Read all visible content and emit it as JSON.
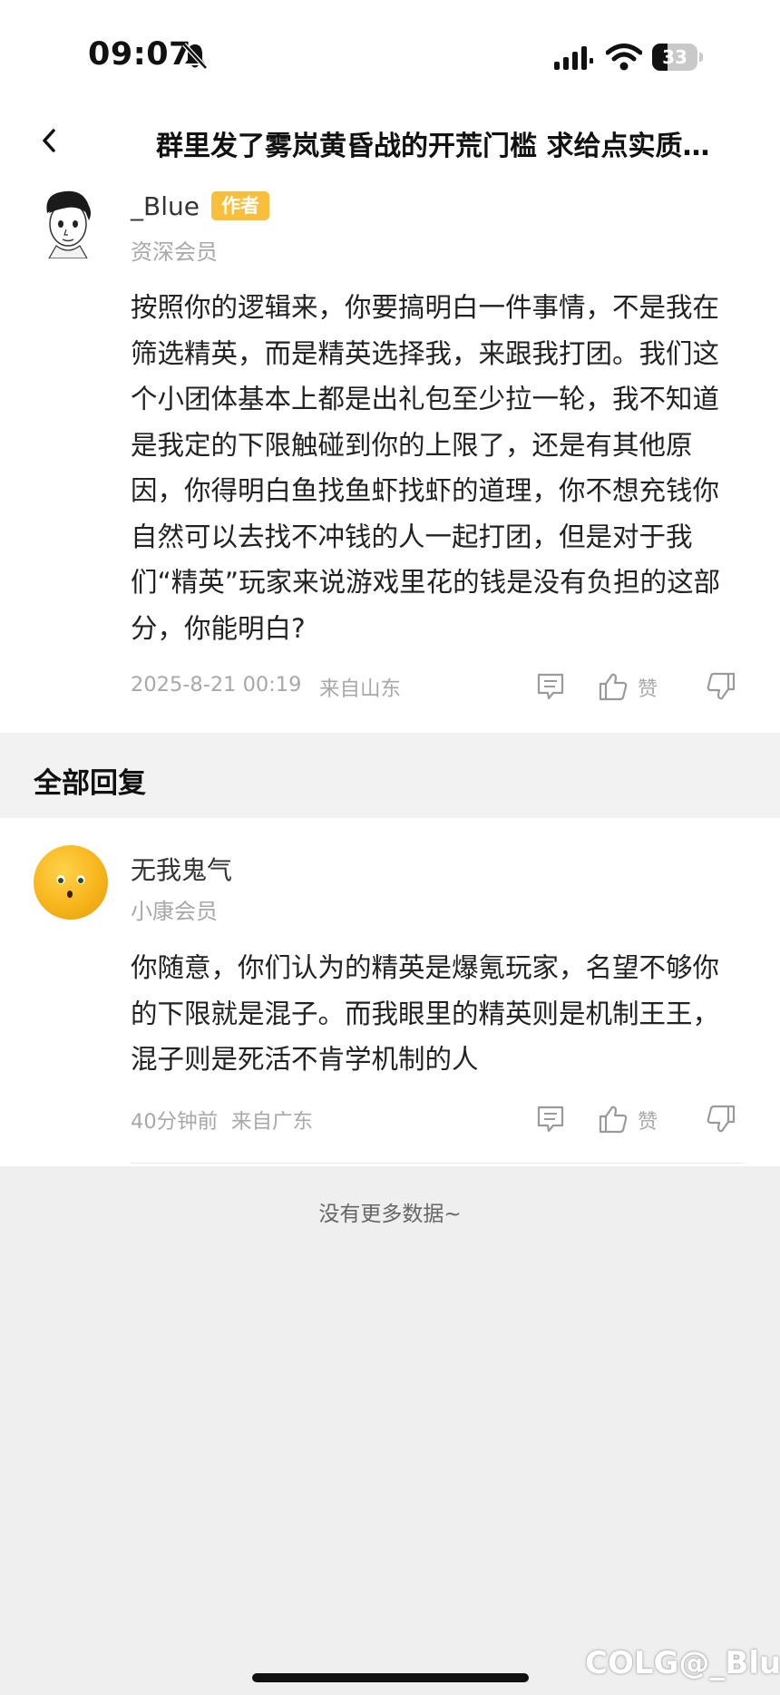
{
  "status_bar": {
    "time": "09:07",
    "battery": "33",
    "battery_level": 0.33,
    "icons": [
      "bell-slash-icon",
      "signal-icon",
      "wifi-icon",
      "battery-icon"
    ]
  },
  "nav": {
    "back_icon": "chevron-left-icon",
    "title": "群里发了雾岚黄昏战的开荒门槛 求给点实质…"
  },
  "main_post": {
    "author": "_Blue",
    "badge": "作者",
    "member_level": "资深会员",
    "content": "按照你的逻辑来，你要搞明白一件事情，不是我在筛选精英，而是精英选择我，来跟我打团。我们这个小团体基本上都是出礼包至少拉一轮，我不知道是我定的下限触碰到你的上限了，还是有其他原因，你得明白鱼找鱼虾找虾的道理，你不想充钱你自然可以去找不冲钱的人一起打团，但是对于我们“精英”玩家来说游戏里花的钱是没有负担的这部分，你能明白?",
    "time": "2025-8-21 00:19",
    "location": "来自山东",
    "like_label": "赞"
  },
  "replies_section": {
    "title": "全部回复",
    "replies": [
      {
        "author": "无我鬼气",
        "member_level": "小康会员",
        "content": "你随意，你们认为的精英是爆氪玩家，名望不够你的下限就是混子。而我眼里的精英则是机制王王，混子则是死活不肯学机制的人",
        "time": "40分钟前",
        "location": "来自广东",
        "like_label": "赞"
      }
    ]
  },
  "footer": {
    "no_more": "没有更多数据~",
    "watermark": "COLG@_Blue"
  },
  "colors": {
    "author_badge": "#f9bf3b",
    "background_gray": "#efefef",
    "meta_gray": "#a8a8a8"
  }
}
